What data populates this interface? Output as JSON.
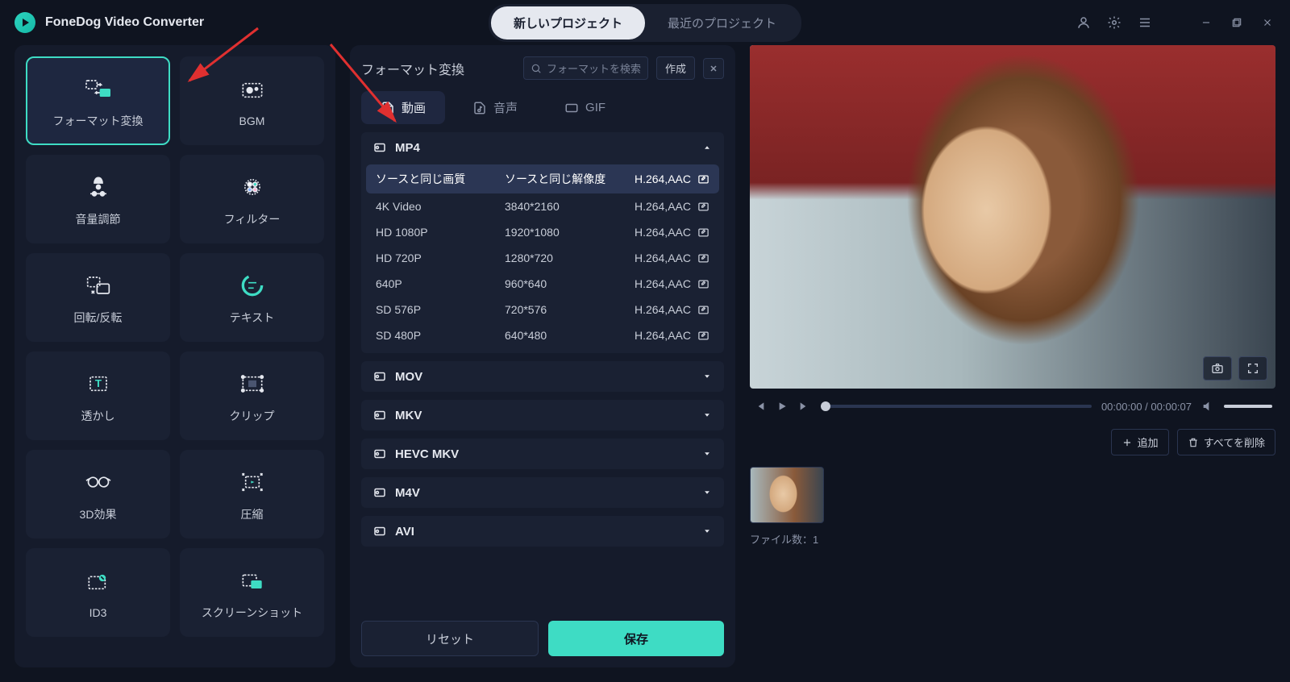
{
  "app": {
    "title": "FoneDog Video Converter"
  },
  "titleTabs": {
    "new": "新しいプロジェクト",
    "recent": "最近のプロジェクト"
  },
  "sidebar": {
    "tools": [
      {
        "label": "フォーマット変換",
        "selected": true
      },
      {
        "label": "BGM"
      },
      {
        "label": "音量調節"
      },
      {
        "label": "フィルター"
      },
      {
        "label": "回転/反転"
      },
      {
        "label": "テキスト"
      },
      {
        "label": "透かし"
      },
      {
        "label": "クリップ"
      },
      {
        "label": "3D効果"
      },
      {
        "label": "圧縮"
      },
      {
        "label": "ID3"
      },
      {
        "label": "スクリーンショット"
      }
    ]
  },
  "panel": {
    "title": "フォーマット変換",
    "searchPlaceholder": "フォーマットを検索",
    "createLabel": "作成",
    "mediaTabs": {
      "video": "動画",
      "audio": "音声",
      "gif": "GIF"
    },
    "expanded": {
      "name": "MP4",
      "rows": [
        {
          "quality": "ソースと同じ画質",
          "resolution": "ソースと同じ解像度",
          "codec": "H.264,AAC",
          "selected": true
        },
        {
          "quality": "4K Video",
          "resolution": "3840*2160",
          "codec": "H.264,AAC"
        },
        {
          "quality": "HD 1080P",
          "resolution": "1920*1080",
          "codec": "H.264,AAC"
        },
        {
          "quality": "HD 720P",
          "resolution": "1280*720",
          "codec": "H.264,AAC"
        },
        {
          "quality": "640P",
          "resolution": "960*640",
          "codec": "H.264,AAC"
        },
        {
          "quality": "SD 576P",
          "resolution": "720*576",
          "codec": "H.264,AAC"
        },
        {
          "quality": "SD 480P",
          "resolution": "640*480",
          "codec": "H.264,AAC"
        }
      ]
    },
    "collapsed": [
      "MOV",
      "MKV",
      "HEVC MKV",
      "M4V",
      "AVI"
    ],
    "resetLabel": "リセット",
    "saveLabel": "保存"
  },
  "preview": {
    "time": "00:00:00 / 00:00:07",
    "addLabel": "追加",
    "deleteAllLabel": "すべてを削除",
    "fileCountLabel": "ファイル数：",
    "fileCount": "1"
  }
}
